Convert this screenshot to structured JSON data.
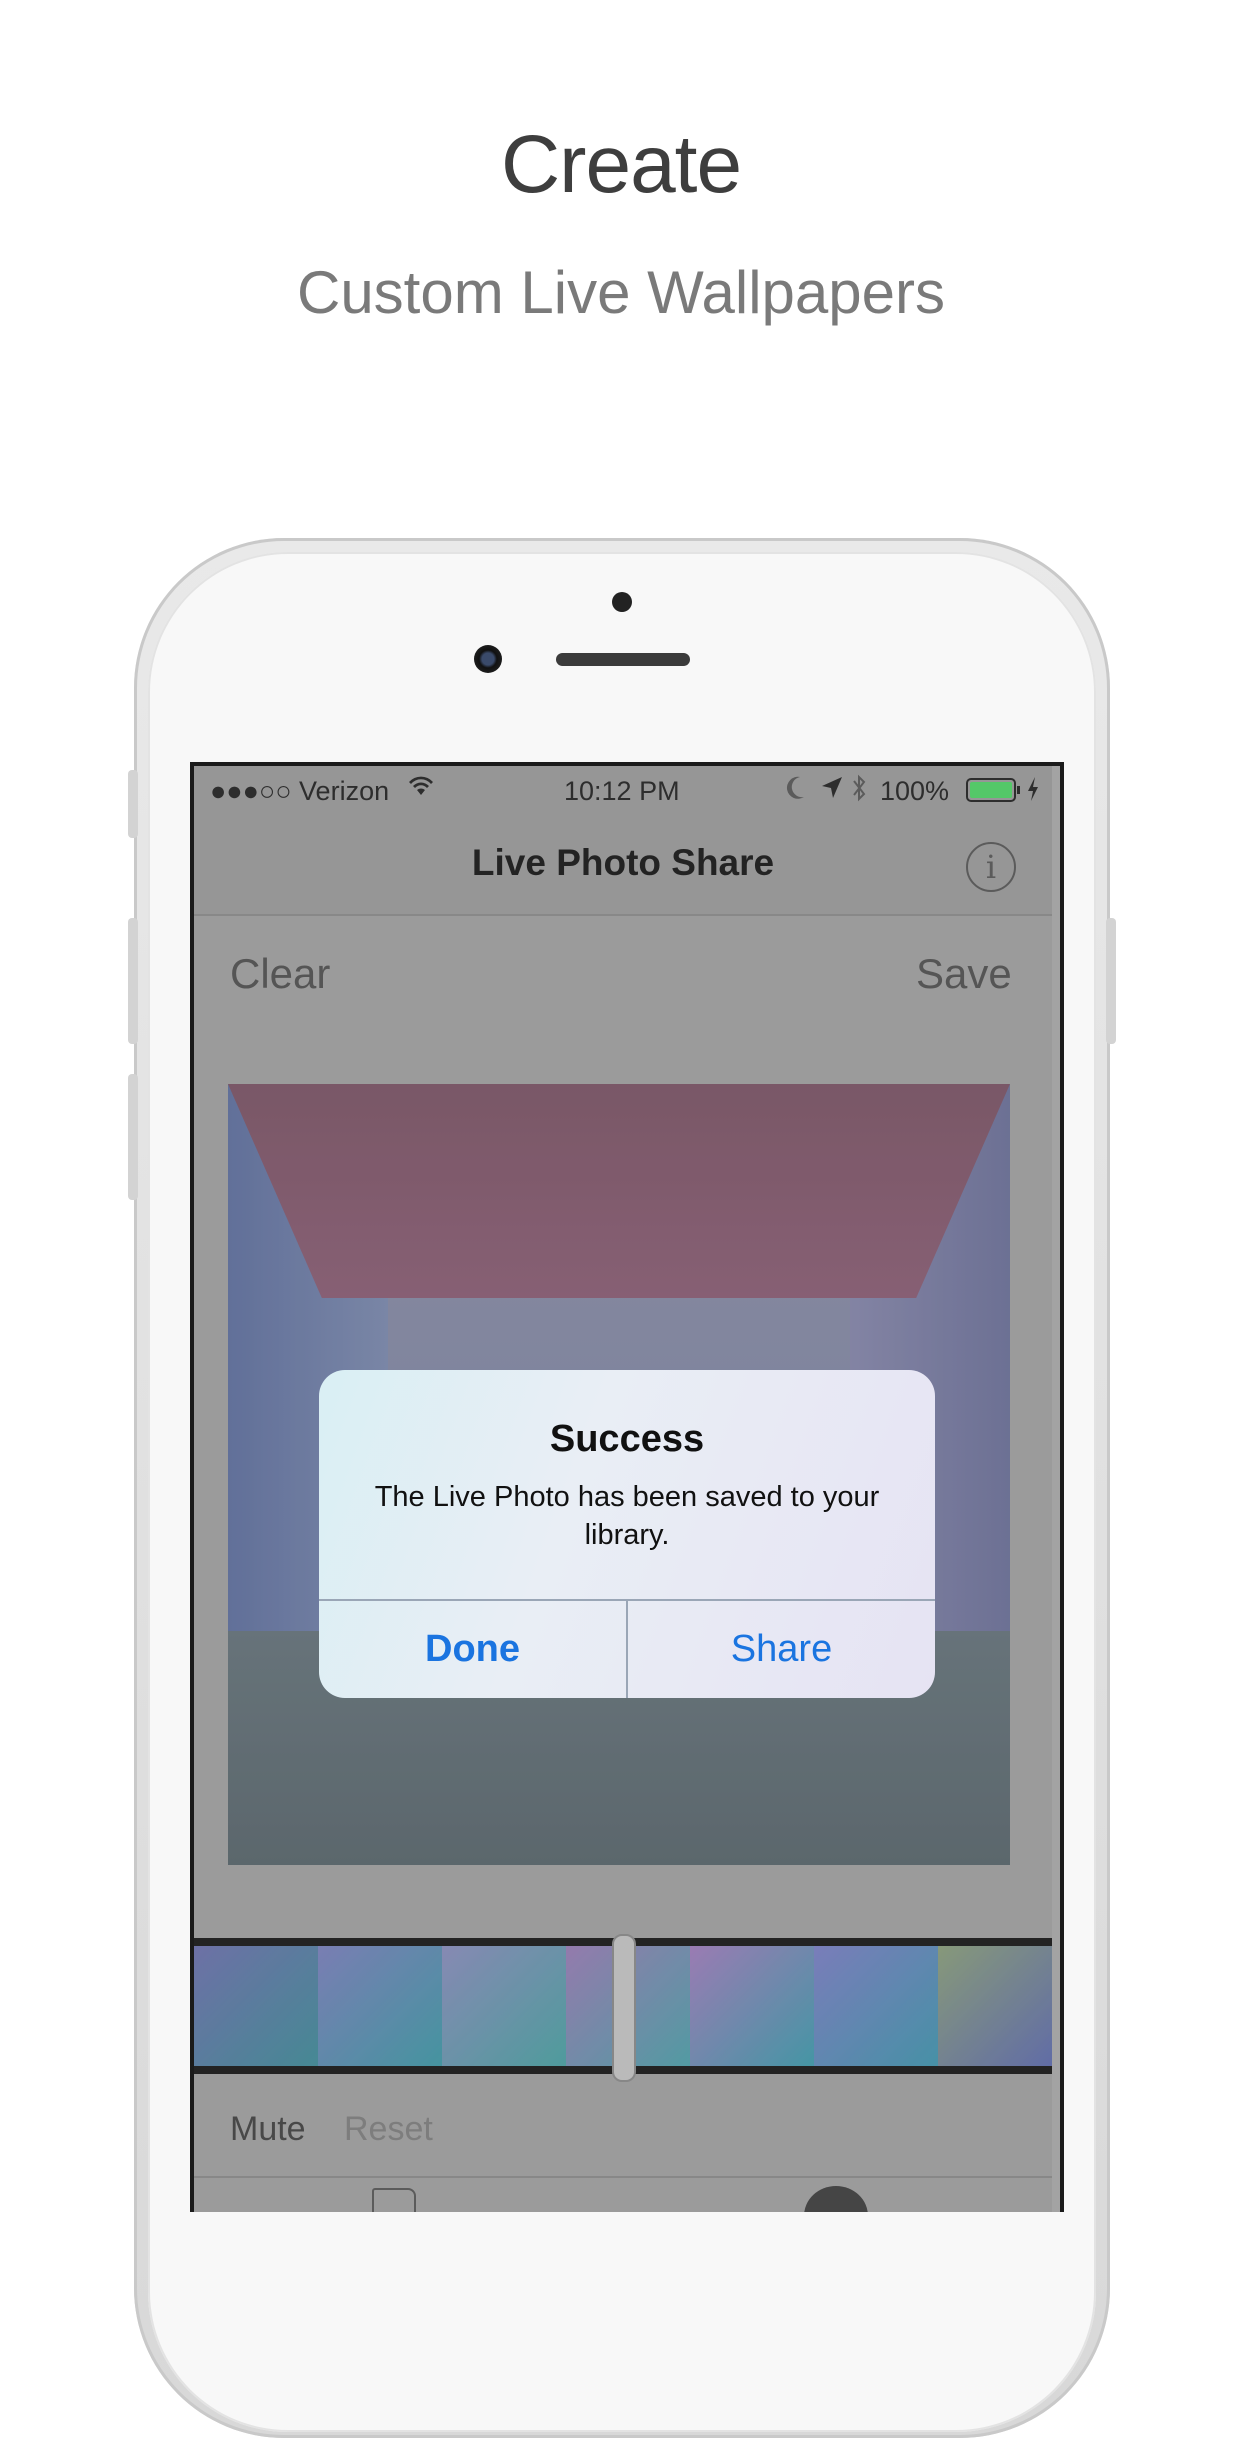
{
  "promo": {
    "headline": "Create",
    "subheadline": "Custom Live Wallpapers"
  },
  "status_bar": {
    "carrier": "●●●○○ Verizon",
    "time": "10:12 PM",
    "battery": "100%"
  },
  "nav": {
    "title": "Live Photo Share",
    "info_icon": "i"
  },
  "toolbar": {
    "clear": "Clear",
    "save": "Save"
  },
  "alert": {
    "title": "Success",
    "message": "The Live Photo has been saved to your library.",
    "done": "Done",
    "share": "Share"
  },
  "bottom": {
    "mute": "Mute",
    "reset": "Reset"
  },
  "colors": {
    "accent": "#1a74e0",
    "battery": "#4cd964"
  },
  "icons": [
    "wifi-icon",
    "moon-icon",
    "location-arrow-icon",
    "bluetooth-icon",
    "battery-icon",
    "charging-icon",
    "info-icon"
  ]
}
